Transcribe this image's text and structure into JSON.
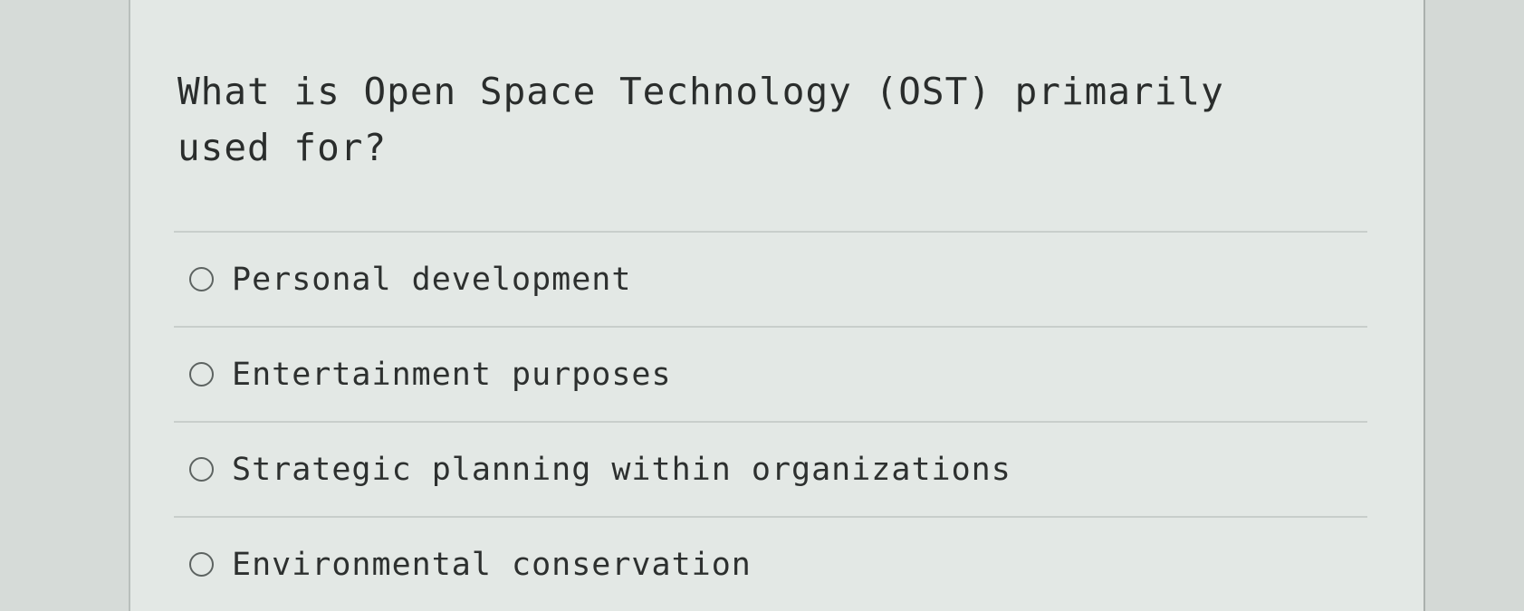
{
  "question": {
    "text": "What is Open Space Technology (OST) primarily used for?"
  },
  "options": [
    {
      "label": "Personal development",
      "selected": false
    },
    {
      "label": "Entertainment purposes",
      "selected": false
    },
    {
      "label": "Strategic planning within organizations",
      "selected": false
    },
    {
      "label": "Environmental conservation",
      "selected": false
    }
  ],
  "colors": {
    "background": "#e3e8e5",
    "text": "#2a2d2c",
    "divider": "#c8cecb"
  }
}
